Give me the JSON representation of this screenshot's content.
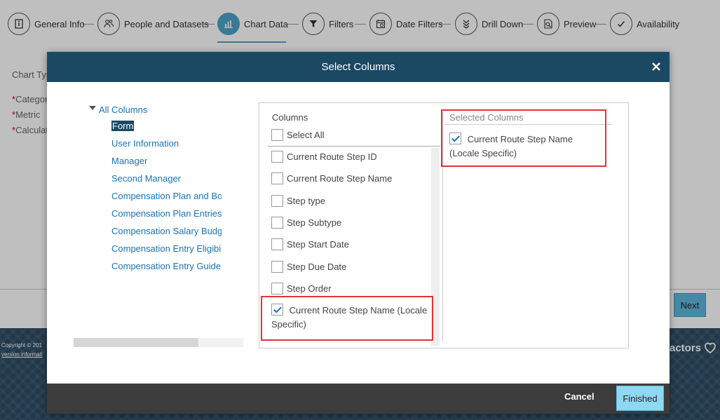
{
  "wizard": {
    "steps": [
      {
        "label": "General Info",
        "icon": "info-icon"
      },
      {
        "label": "People and Datasets",
        "icon": "people-icon"
      },
      {
        "label": "Chart Data",
        "icon": "bar-chart-icon",
        "active": true
      },
      {
        "label": "Filters",
        "icon": "filter-icon"
      },
      {
        "label": "Date Filters",
        "icon": "calendar-icon"
      },
      {
        "label": "Drill Down",
        "icon": "drill-down-icon"
      },
      {
        "label": "Preview",
        "icon": "preview-icon"
      },
      {
        "label": "Availability",
        "icon": "check-icon"
      }
    ]
  },
  "background": {
    "chart_type_label": "Chart Typ",
    "category_label": "Categor",
    "metric_label": "Metric",
    "calculation_label": "Calculat",
    "required_marker": "*",
    "next_label": "Next",
    "copyright_text": "Copyright © 201",
    "version_text": "version informati",
    "brand_text": "actors"
  },
  "modal": {
    "title": "Select Columns",
    "close_icon": "close-icon",
    "tree": {
      "root_label": "All Columns",
      "items": [
        "Form",
        "User Information",
        "Manager",
        "Second Manager",
        "Compensation Plan and Bonus St",
        "Compensation Plan Entries",
        "Compensation Salary Budget Info",
        "Compensation Entry Eligibility Infc",
        "Compensation Entry GuideLine In"
      ],
      "selected_index": 0
    },
    "columns": {
      "title": "Columns",
      "select_all_label": "Select All",
      "items": [
        {
          "label": "Current Route Step ID",
          "checked": false
        },
        {
          "label": "Current Route Step Name",
          "checked": false
        },
        {
          "label": "Step type",
          "checked": false
        },
        {
          "label": "Step Subtype",
          "checked": false
        },
        {
          "label": "Step Start Date",
          "checked": false
        },
        {
          "label": "Step Due Date",
          "checked": false
        },
        {
          "label": "Step Order",
          "checked": false
        },
        {
          "label": "Current Route Step Name (Locale Specific)",
          "checked": true
        }
      ]
    },
    "selected": {
      "title": "Selected Columns",
      "items": [
        "Current Route Step Name (Locale Specific)"
      ]
    },
    "footer": {
      "cancel_label": "Cancel",
      "finished_label": "Finished"
    }
  },
  "colors": {
    "header": "#1b4964",
    "accent": "#4ea3c9",
    "link": "#1a73b5",
    "highlight": "#e0343c",
    "finished": "#8fd8f2"
  }
}
